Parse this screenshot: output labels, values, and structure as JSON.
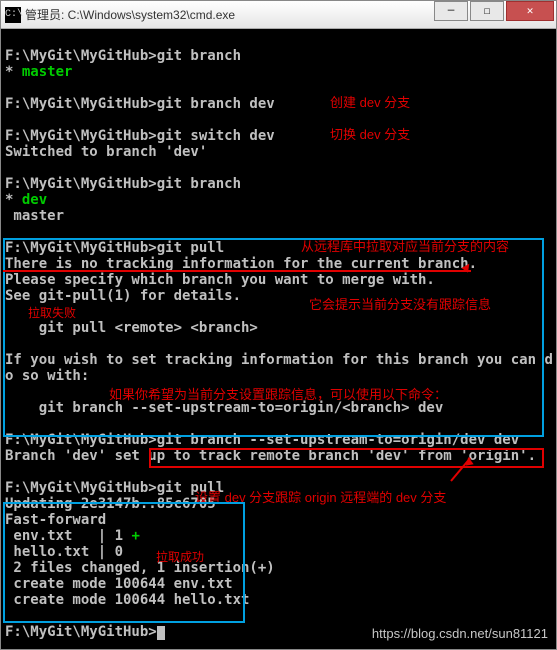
{
  "titlebar": {
    "icon_label": "C:\\",
    "title": "管理员: C:\\Windows\\system32\\cmd.exe"
  },
  "win_buttons": {
    "min": "—",
    "max": "☐",
    "close": "✕"
  },
  "prompt": "F:\\MyGit\\MyGitHub>",
  "cmds": {
    "git_branch": "git branch",
    "git_branch_dev": "git branch dev",
    "git_switch_dev": "git switch dev",
    "switched_msg": "Switched to branch 'dev'",
    "git_pull": "git pull",
    "no_tracking": "There is no tracking information for the current branch.",
    "specify": "Please specify which branch you want to merge with.",
    "see_help": "See git-pull(1) for details.",
    "pull_usage": "    git pull <remote> <branch>",
    "if_wish": "If you wish to set tracking information for this branch you can d",
    "o_so": "o so with:",
    "set_upstream_usage": "    git branch --set-upstream-to=origin/<branch> dev",
    "set_upstream_cmd": "git branch --set-upstream-to=origin/dev dev",
    "branch_setup": "Branch 'dev' set up to track remote branch 'dev' from 'origin'.",
    "updating": "Updating 2e3147b..85c6705",
    "fast_forward": "Fast-forward",
    "file1": " env.txt   | 1 ",
    "file1_plus": "+",
    "file2": " hello.txt | 0",
    "changed": " 2 files changed, 1 insertion(+)",
    "create1": " create mode 100644 env.txt",
    "create2": " create mode 100644 hello.txt"
  },
  "branches": {
    "master": " master",
    "master_star": "* ",
    "master_name": "master",
    "dev_star": "* ",
    "dev_name": "dev"
  },
  "annos": {
    "create_dev": "创建 dev 分支",
    "switch_dev": "切换 dev 分支",
    "pull_remote": "从远程库中拉取对应当前分支的内容",
    "no_track_tip": "它会提示当前分支没有跟踪信息",
    "pull_fail": "拉取失败",
    "set_track_tip": "如果你希望为当前分支设置跟踪信息，可以使用以下命令：",
    "set_dev_track": "设置 dev 分支跟踪 origin 远程端的 dev 分支",
    "pull_success": "拉取成功"
  },
  "watermark": "https://blog.csdn.net/sun81121"
}
